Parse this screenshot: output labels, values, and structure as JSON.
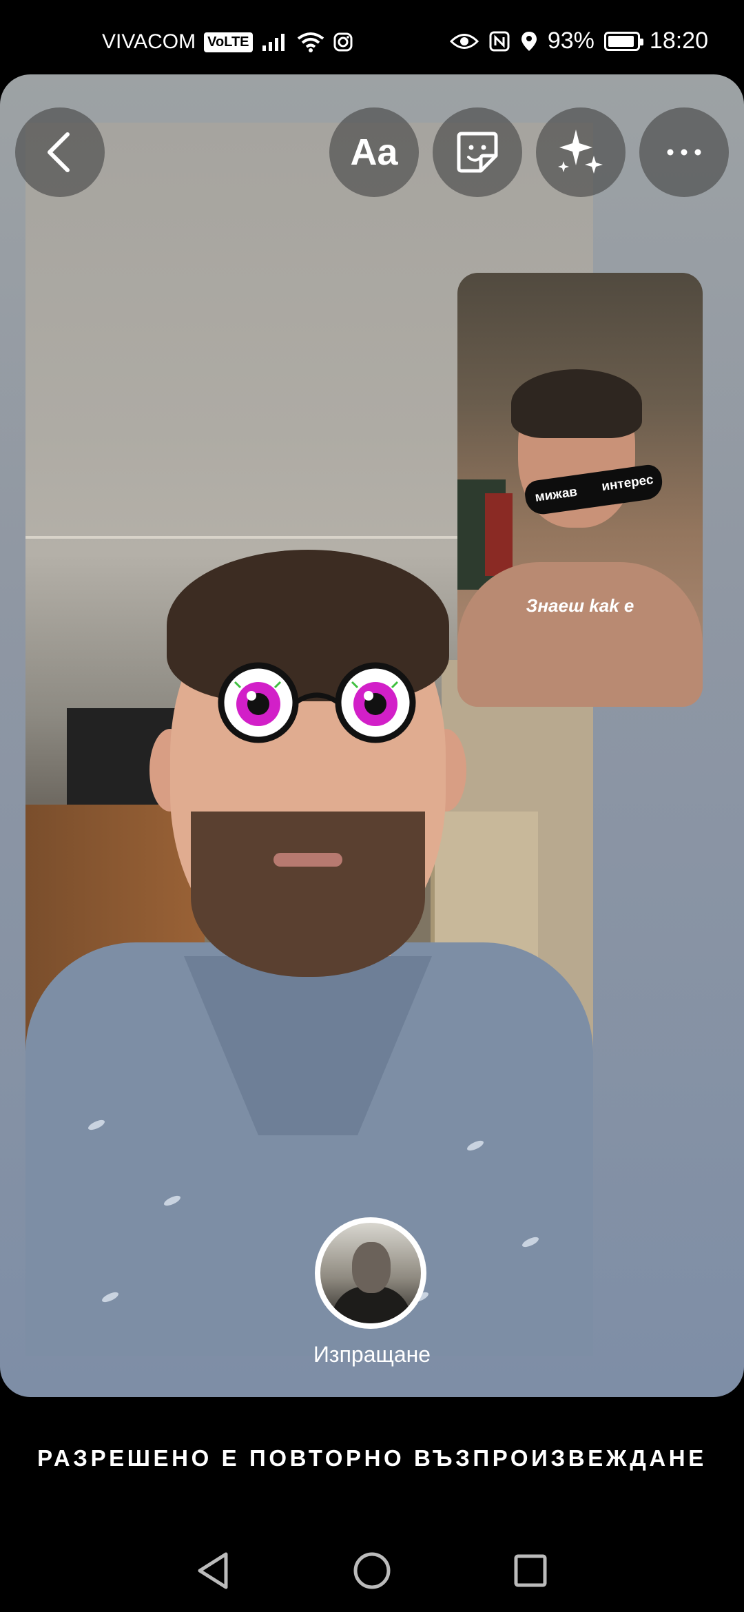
{
  "status_bar": {
    "carrier": "VIVACOM",
    "volte": "VoLTE",
    "battery_percent": "93%",
    "battery_level": 0.93,
    "time": "18:20",
    "icons": [
      "signal-icon",
      "wifi-icon",
      "instagram-icon",
      "eye-icon",
      "nfc-icon",
      "location-icon",
      "battery-icon"
    ]
  },
  "toolbar": {
    "back_icon": "chevron-left-icon",
    "text_label": "Aa",
    "sticker_icon": "sticker-icon",
    "effects_icon": "sparkles-icon",
    "more_icon": "more-icon"
  },
  "story_overlay": {
    "sunglasses_left": "мижав",
    "sunglasses_right": "интерес",
    "caption": "Знаеш kak e"
  },
  "send": {
    "label": "Изпращане"
  },
  "replay_option": "РАЗРЕШЕНО Е ПОВТОРНО ВЪЗПРОИЗВЕЖДАНЕ",
  "nav_bar": {
    "icons": [
      "back-triangle-icon",
      "home-circle-icon",
      "recents-square-icon"
    ]
  },
  "colors": {
    "eye_iris": "#d21fc8",
    "toolbar_button_bg": "#464646"
  }
}
